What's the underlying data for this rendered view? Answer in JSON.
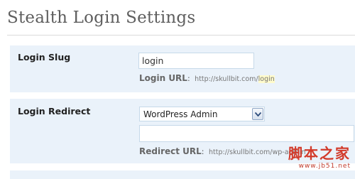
{
  "page": {
    "title": "Stealth Login Settings"
  },
  "login_slug": {
    "label": "Login Slug",
    "value": "login",
    "help_label": "Login URL",
    "help_colon": ":",
    "help_url_base": "http://skullbit.com/",
    "help_url_slug": "login"
  },
  "login_redirect": {
    "label": "Login Redirect",
    "selected": "WordPress Admin",
    "url_value": "",
    "help_label": "Redirect URL",
    "help_colon": ":",
    "help_url": "http://skullbit.com/wp-admin"
  },
  "watermark": {
    "text": "脚本之家",
    "url": "www.jb51.net"
  },
  "colors": {
    "row_background": "#eaf2fa",
    "input_border": "#c6d9e9",
    "slug_highlight": "#fffbcc"
  },
  "icons": {
    "select_toggle": "chevron-down-icon"
  }
}
